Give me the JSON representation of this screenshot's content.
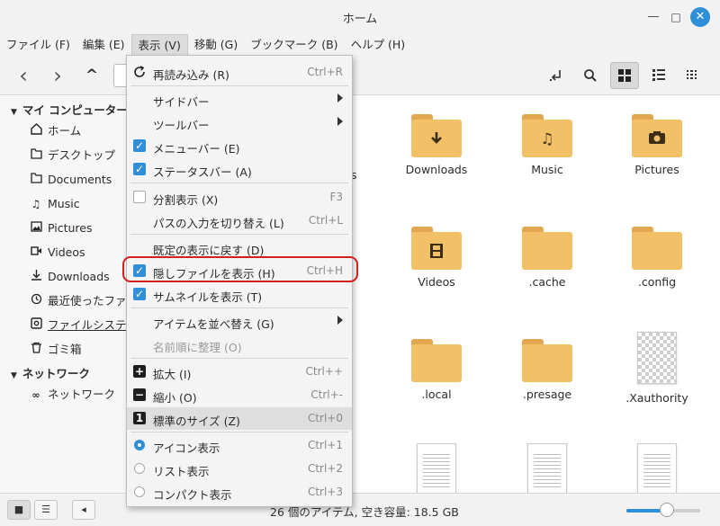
{
  "window": {
    "title": "ホーム",
    "min": "—",
    "max": "□",
    "close": "✕"
  },
  "menubar": [
    "ファイル (F)",
    "編集 (E)",
    "表示 (V)",
    "移動 (G)",
    "ブックマーク (B)",
    "ヘルプ (H)"
  ],
  "toolbar": {
    "back": "‹",
    "forward": "›",
    "up": "^"
  },
  "sidebar": {
    "computer_header": "マイ コンピューター",
    "places": [
      {
        "label": "ホーム",
        "icon": "home-icon"
      },
      {
        "label": "デスクトップ",
        "icon": "desktop-icon"
      },
      {
        "label": "Documents",
        "icon": "documents-icon"
      },
      {
        "label": "Music",
        "icon": "music-icon"
      },
      {
        "label": "Pictures",
        "icon": "pictures-icon"
      },
      {
        "label": "Videos",
        "icon": "videos-icon"
      },
      {
        "label": "Downloads",
        "icon": "downloads-icon"
      },
      {
        "label": "最近使ったファイル",
        "icon": "recent-icon"
      },
      {
        "label": "ファイルシステム",
        "icon": "filesystem-icon"
      },
      {
        "label": "ゴミ箱",
        "icon": "trash-icon"
      }
    ],
    "network_header": "ネットワーク",
    "network": [
      {
        "label": "ネットワーク",
        "icon": "network-icon"
      }
    ]
  },
  "files": [
    {
      "name": "Downloads",
      "kind": "folder",
      "icon": "download-icon"
    },
    {
      "name": "Music",
      "kind": "folder",
      "icon": "music-note-icon"
    },
    {
      "name": "Pictures",
      "kind": "folder",
      "icon": "camera-icon"
    },
    {
      "name": "Videos",
      "kind": "folder",
      "icon": "film-icon"
    },
    {
      "name": ".cache",
      "kind": "folder",
      "icon": ""
    },
    {
      "name": ".config",
      "kind": "folder",
      "icon": ""
    },
    {
      "name": ".local",
      "kind": "folder",
      "icon": ""
    },
    {
      "name": ".presage",
      "kind": "folder",
      "icon": ""
    },
    {
      "name": ".Xauthority",
      "kind": "image",
      "icon": ""
    },
    {
      "name": "",
      "kind": "document",
      "icon": ""
    },
    {
      "name": "",
      "kind": "document",
      "icon": ""
    },
    {
      "name": "",
      "kind": "document",
      "icon": ""
    }
  ],
  "partial_label": "s",
  "status": {
    "text": "26 個のアイテム, 空き容量: 18.5 GB",
    "zoom_fraction": 0.55
  },
  "view_menu": {
    "items": [
      {
        "label": "再読み込み (R)",
        "shortcut": "Ctrl+R",
        "type": "icon",
        "icon": "reload-icon"
      },
      {
        "label": "サイドバー",
        "type": "submenu"
      },
      {
        "label": "ツールバー",
        "type": "submenu"
      },
      {
        "label": "メニューバー (E)",
        "type": "check",
        "checked": true
      },
      {
        "label": "ステータスバー (A)",
        "type": "check",
        "checked": true
      },
      {
        "label": "分割表示 (X)",
        "shortcut": "F3",
        "type": "check",
        "checked": false
      },
      {
        "label": "パスの入力を切り替え (L)",
        "shortcut": "Ctrl+L",
        "type": "plain"
      },
      {
        "label": "既定の表示に戻す (D)",
        "type": "plain"
      },
      {
        "label": "隠しファイルを表示 (H)",
        "shortcut": "Ctrl+H",
        "type": "check",
        "checked": true
      },
      {
        "label": "サムネイルを表示 (T)",
        "type": "check",
        "checked": true
      },
      {
        "label": "アイテムを並べ替え (G)",
        "type": "submenu"
      },
      {
        "label": "名前順に整理 (O)",
        "type": "disabled"
      },
      {
        "label": "拡大 (I)",
        "shortcut": "Ctrl++",
        "type": "icon",
        "icon": "zoom-in-icon"
      },
      {
        "label": "縮小 (O)",
        "shortcut": "Ctrl+-",
        "type": "icon",
        "icon": "zoom-out-icon"
      },
      {
        "label": "標準のサイズ (Z)",
        "shortcut": "Ctrl+0",
        "type": "icon",
        "icon": "normal-size-icon"
      },
      {
        "label": "アイコン表示",
        "shortcut": "Ctrl+1",
        "type": "radio",
        "checked": true
      },
      {
        "label": "リスト表示",
        "shortcut": "Ctrl+2",
        "type": "radio",
        "checked": false
      },
      {
        "label": "コンパクト表示",
        "shortcut": "Ctrl+3",
        "type": "radio",
        "checked": false
      }
    ],
    "glyphs": {
      "plus": "+",
      "minus": "−",
      "one": "1",
      "check": "✓"
    }
  },
  "colors": {
    "accent": "#2f8fd8",
    "folder": "#f2c066",
    "highlight_box": "#d22020"
  }
}
